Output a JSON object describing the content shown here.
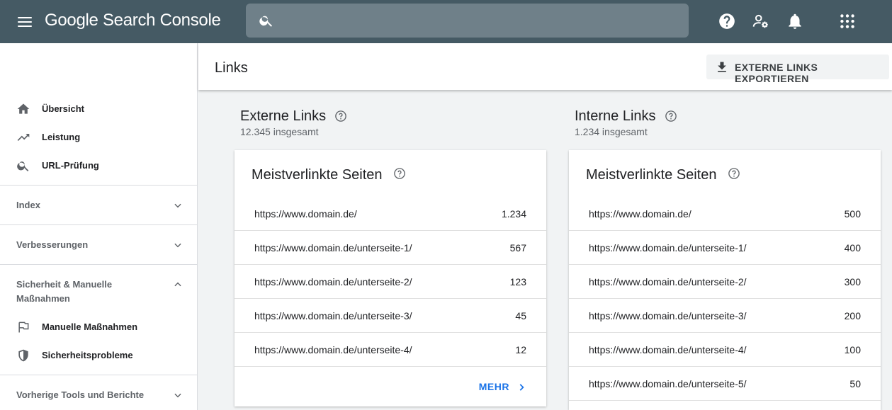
{
  "app": {
    "title": "Google Search Console"
  },
  "search": {
    "placeholder": ""
  },
  "topbar": {
    "icons": [
      "help-icon",
      "manage-users-icon",
      "notifications-icon",
      "apps-grid-icon"
    ]
  },
  "sidebar": {
    "items": [
      {
        "label": "Übersicht",
        "icon": "home-icon"
      },
      {
        "label": "Leistung",
        "icon": "trending-up-icon"
      },
      {
        "label": "URL-Prüfung",
        "icon": "search-icon"
      }
    ],
    "sections": [
      {
        "title": "Index",
        "expanded": false
      },
      {
        "title": "Verbesserungen",
        "expanded": false
      },
      {
        "title": "Sicherheit & Manuelle Maßnahmen",
        "expanded": true,
        "items": [
          {
            "label": "Manuelle Maßnahmen",
            "icon": "flag-icon"
          },
          {
            "label": "Sicherheitsprobleme",
            "icon": "shield-icon"
          }
        ]
      },
      {
        "title": "Vorherige Tools und Berichte",
        "expanded": false
      }
    ]
  },
  "header": {
    "title": "Links",
    "export_label": "EXTERNE LINKS EXPORTIEREN"
  },
  "external": {
    "title": "Externe Links",
    "subtitle": "12.345 insgesamt",
    "card_title": "Meistverlinkte Seiten",
    "rows": [
      {
        "url": "https://www.domain.de/",
        "count": "1.234"
      },
      {
        "url": "https://www.domain.de/unterseite-1/",
        "count": "567"
      },
      {
        "url": "https://www.domain.de/unterseite-2/",
        "count": "123"
      },
      {
        "url": "https://www.domain.de/unterseite-3/",
        "count": "45"
      },
      {
        "url": "https://www.domain.de/unterseite-4/",
        "count": "12"
      }
    ],
    "more_label": "MEHR"
  },
  "internal": {
    "title": "Interne Links",
    "subtitle": "1.234 insgesamt",
    "card_title": "Meistverlinkte Seiten",
    "rows": [
      {
        "url": "https://www.domain.de/",
        "count": "500"
      },
      {
        "url": "https://www.domain.de/unterseite-1/",
        "count": "400"
      },
      {
        "url": "https://www.domain.de/unterseite-2/",
        "count": "300"
      },
      {
        "url": "https://www.domain.de/unterseite-3/",
        "count": "200"
      },
      {
        "url": "https://www.domain.de/unterseite-4/",
        "count": "100"
      },
      {
        "url": "https://www.domain.de/unterseite-5/",
        "count": "50"
      }
    ]
  },
  "colors": {
    "topbar": "#455a64",
    "search": "#6f8089",
    "link": "#1a73e8"
  }
}
